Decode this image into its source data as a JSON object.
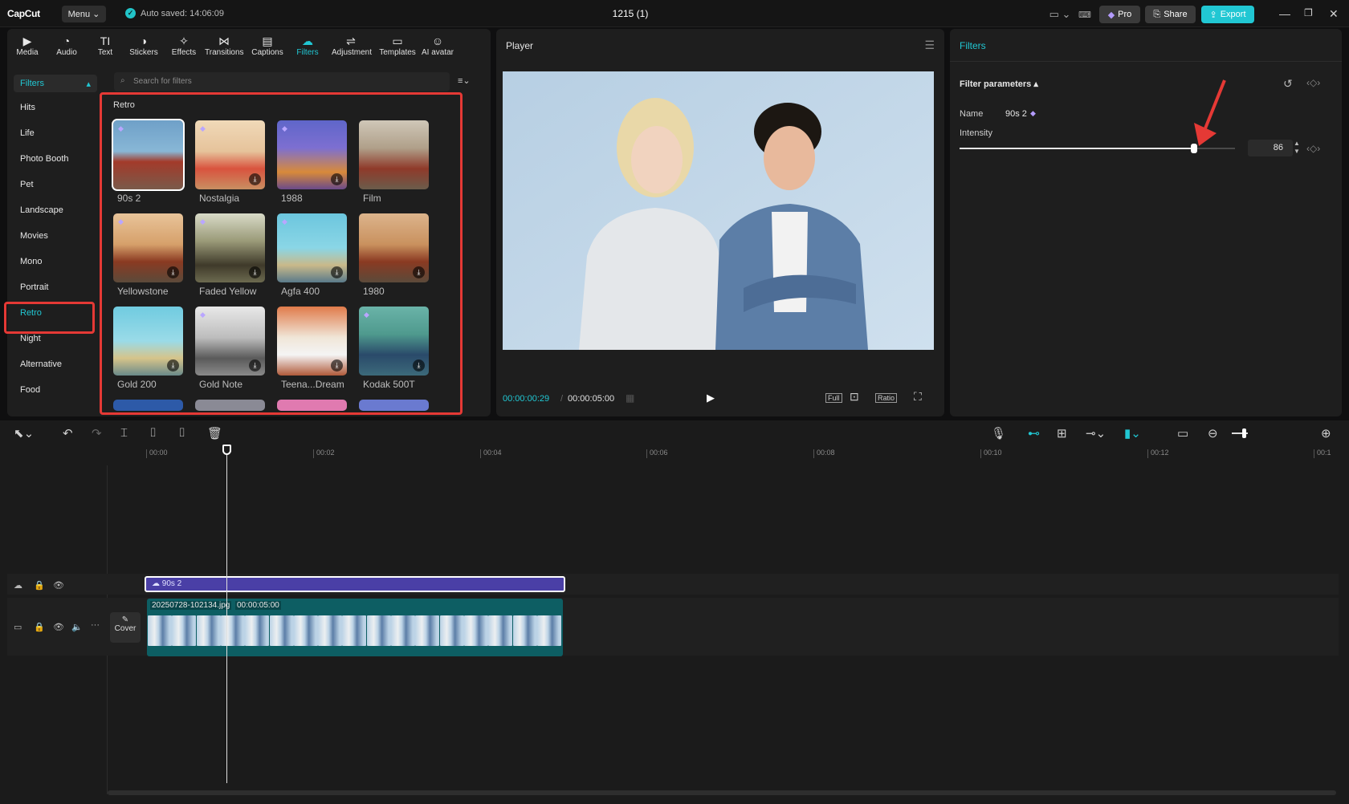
{
  "app": {
    "logo": "CapCut",
    "menu": "Menu",
    "autosave": "Auto saved: 14:06:09",
    "project_title": "1215 (1)",
    "pro": "Pro",
    "share": "Share",
    "export": "Export"
  },
  "toolbar": [
    {
      "label": "Media",
      "icon": "media-icon"
    },
    {
      "label": "Audio",
      "icon": "audio-icon"
    },
    {
      "label": "Text",
      "icon": "text-icon"
    },
    {
      "label": "Stickers",
      "icon": "stickers-icon"
    },
    {
      "label": "Effects",
      "icon": "effects-icon"
    },
    {
      "label": "Transitions",
      "icon": "transitions-icon"
    },
    {
      "label": "Captions",
      "icon": "captions-icon"
    },
    {
      "label": "Filters",
      "icon": "filters-icon"
    },
    {
      "label": "Adjustment",
      "icon": "adjustment-icon"
    },
    {
      "label": "Templates",
      "icon": "templates-icon"
    },
    {
      "label": "AI avatar",
      "icon": "ai-avatar-icon"
    }
  ],
  "left": {
    "header": "Filters",
    "categories": [
      "Hits",
      "Life",
      "Photo Booth",
      "Pet",
      "Landscape",
      "Movies",
      "Mono",
      "Portrait",
      "Retro",
      "Night",
      "Alternative",
      "Food"
    ],
    "active_category": "Retro"
  },
  "filters": {
    "search_placeholder": "Search for filters",
    "section": "Retro",
    "items": [
      {
        "name": "90s 2"
      },
      {
        "name": "Nostalgia"
      },
      {
        "name": "1988"
      },
      {
        "name": "Film"
      },
      {
        "name": "Yellowstone"
      },
      {
        "name": "Faded Yellow"
      },
      {
        "name": "Agfa 400"
      },
      {
        "name": "1980"
      },
      {
        "name": "Gold 200"
      },
      {
        "name": "Gold Note"
      },
      {
        "name": "Teena...Dream"
      },
      {
        "name": "Kodak 500T"
      }
    ]
  },
  "player": {
    "title": "Player",
    "current_time": "00:00:00:29",
    "total_time": "00:00:05:00",
    "full": "Full",
    "ratio": "Ratio"
  },
  "inspector": {
    "tab": "Filters",
    "section": "Filter parameters",
    "name_label": "Name",
    "name_value": "90s 2",
    "intensity_label": "Intensity",
    "intensity_value": "86",
    "intensity": 86
  },
  "timeline": {
    "ticks": [
      "00:00",
      "00:02",
      "00:04",
      "00:06",
      "00:08",
      "00:10",
      "00:12",
      "00:1"
    ],
    "filter_clip": "90s 2",
    "video_clip_name": "20250728-102134.jpg",
    "video_clip_duration": "00:00:05:00",
    "cover": "Cover"
  },
  "colors": {
    "accent": "#21c7d3",
    "filter_track": "#4a3fa6",
    "video_track": "#0d5e63",
    "highlight": "#e53935"
  }
}
